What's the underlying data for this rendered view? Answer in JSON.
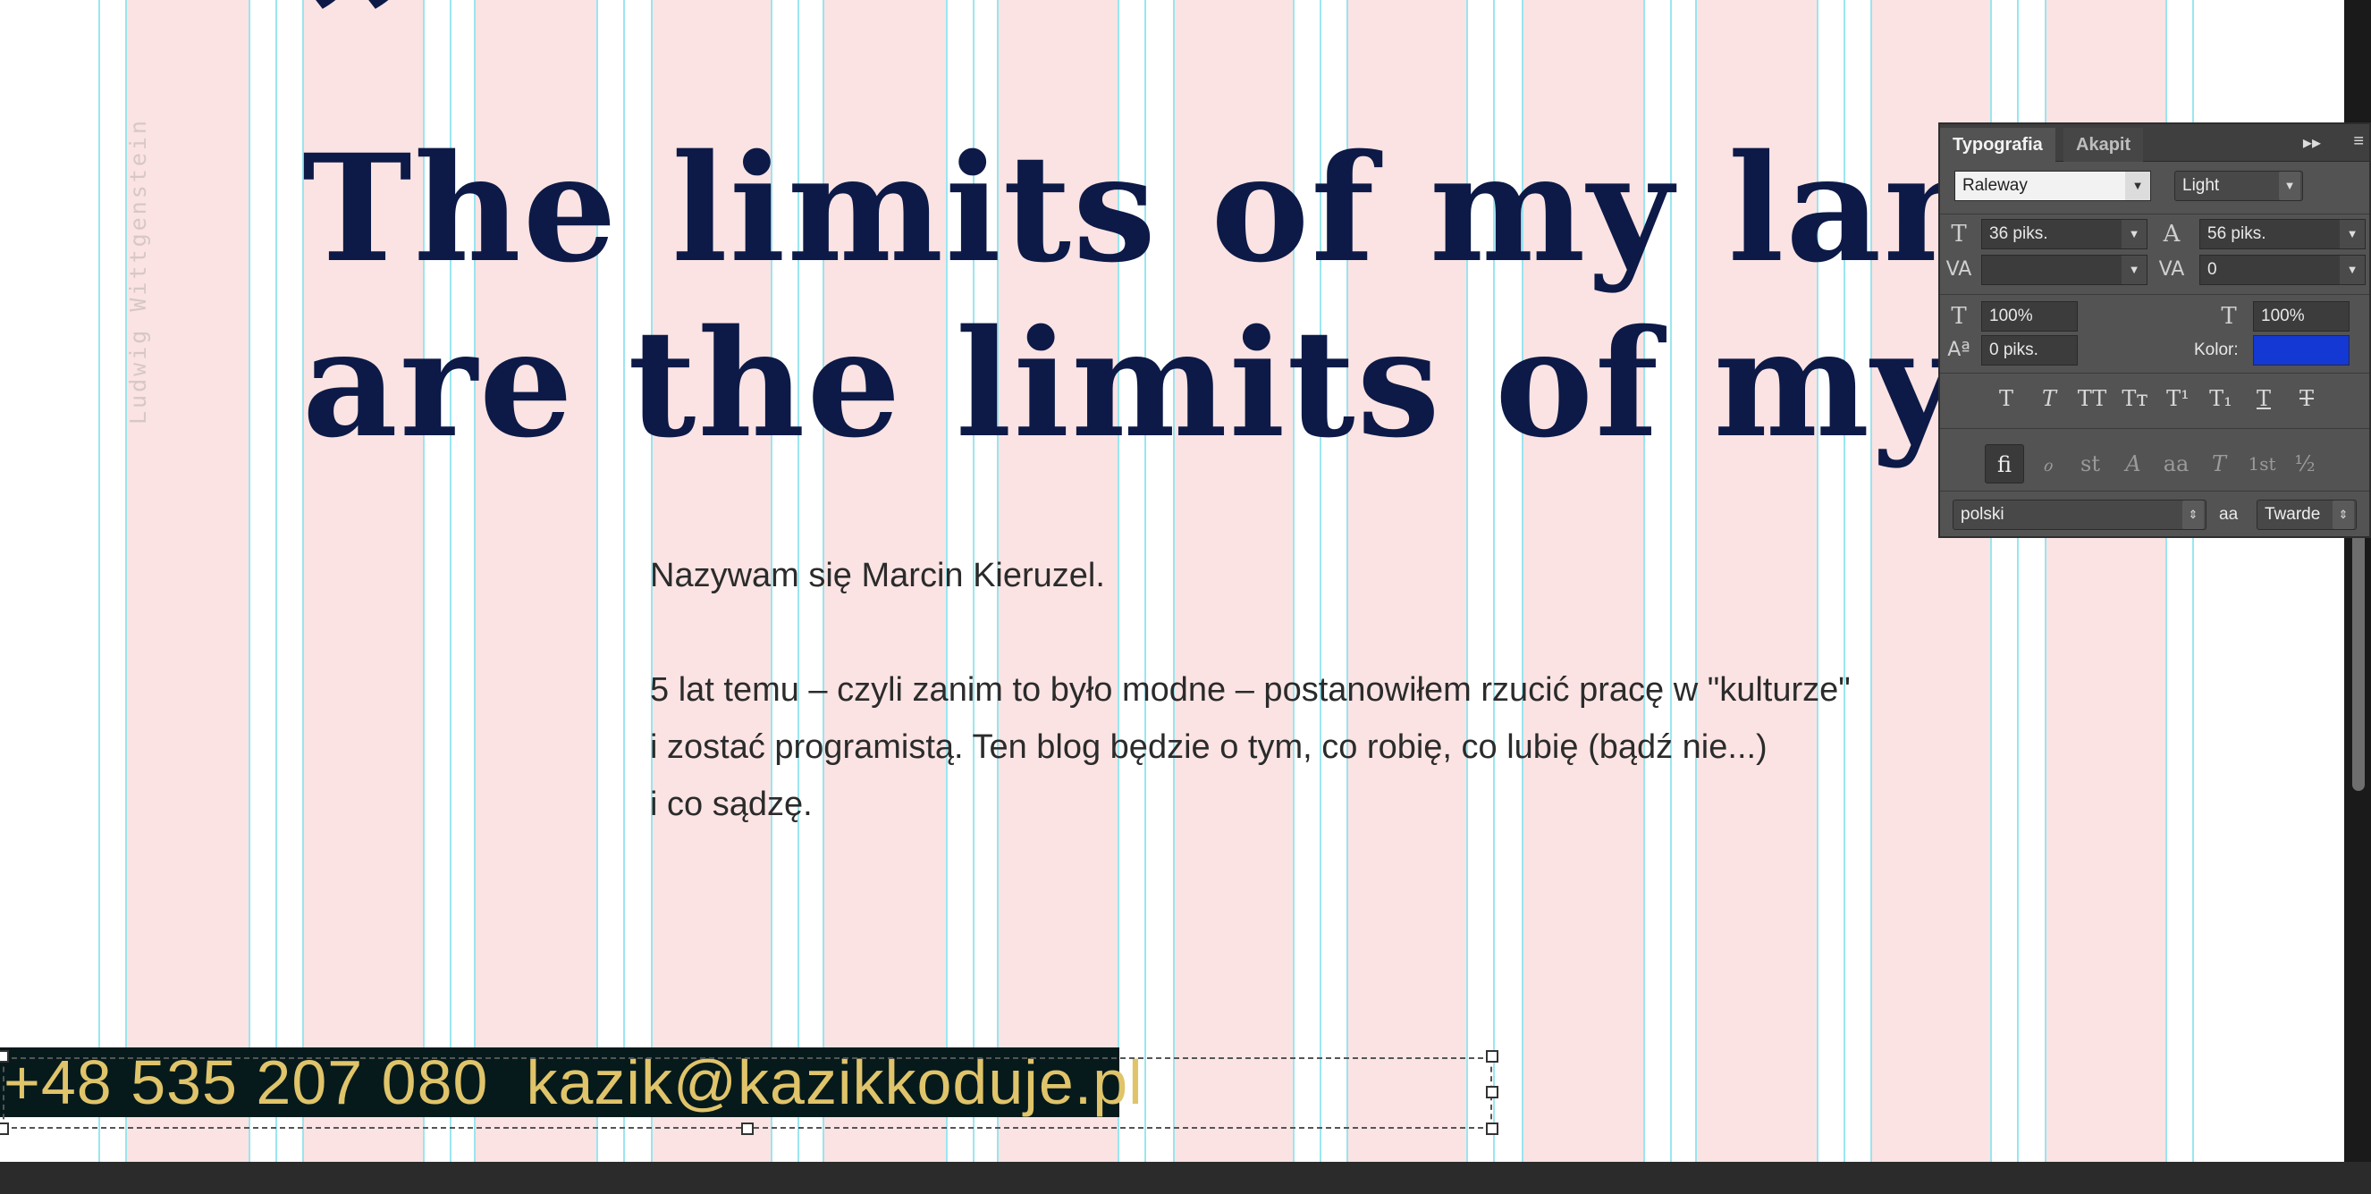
{
  "document": {
    "quote_mark": "”",
    "headline_line1": "The limits of my languag",
    "headline_line2": "are the limits of my world",
    "side_author": "Ludwig Wittgenstein",
    "bio_line1": "Nazywam się Marcin Kieruzel.",
    "bio_line2": "5 lat temu – czyli zanim to było modne – postanowiłem rzucić pracę w \"kulturze\"",
    "bio_line3": "i zostać programistą. Ten blog będzie o tym, co robię, co lubię (bądź nie...)",
    "bio_line4": "i co sądzę.",
    "contact_phone": "+48 535 207 080",
    "contact_email": "kazik@kazikkoduje.pl"
  },
  "typography_panel": {
    "tab_character": "Typografia",
    "tab_paragraph": "Akapit",
    "font_family": "Raleway",
    "font_style": "Light",
    "font_size": "36 piks.",
    "leading": "56 piks.",
    "kerning": "",
    "tracking": "0",
    "vertical_scale": "100%",
    "horizontal_scale": "100%",
    "baseline_shift": "0 piks.",
    "color_label": "Kolor:",
    "color_value": "#1438d4",
    "language": "polski",
    "antialias": "Twarde",
    "aa_icon": "aa",
    "style_buttons": [
      "T",
      "T",
      "TT",
      "Tт",
      "T¹",
      "T₁",
      "T",
      "T"
    ],
    "opentype_buttons": [
      "fi",
      "ℴ",
      "st",
      "A",
      "aa",
      "T",
      "1st",
      "½"
    ]
  },
  "colors": {
    "headline": "#0d1a47",
    "column_band": "#fbe3e3",
    "guide": "#8fe3ee",
    "contact_bg": "#061a1c",
    "contact_text": "#e0c46a"
  }
}
